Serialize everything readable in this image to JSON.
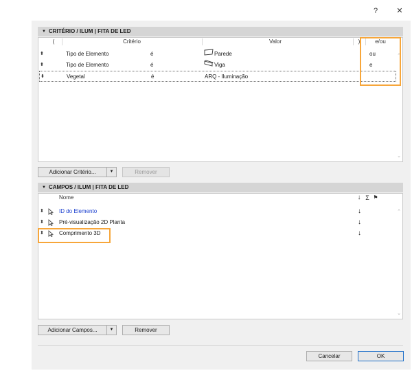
{
  "window": {
    "help": "?",
    "close": "✕"
  },
  "criteria": {
    "title": "CRITÉRIO / ILUM | FITA DE LED",
    "columns": {
      "open_paren": "(",
      "criterio": "Critério",
      "valor": "Valor",
      "close_paren": ")",
      "eou": "e/ou"
    },
    "rows": [
      {
        "criterio": "Tipo de Elemento",
        "op": "é",
        "icon": "wall-icon",
        "valor": "Parede",
        "eou": "ou"
      },
      {
        "criterio": "Tipo de Elemento",
        "op": "é",
        "icon": "beam-icon",
        "valor": "Viga",
        "eou": "e"
      },
      {
        "criterio": "Vegetal",
        "op": "é",
        "icon": "",
        "valor": "ARQ - Iluminação",
        "eou": ""
      }
    ],
    "add_button": "Adicionar Critério...",
    "remove_button": "Remover"
  },
  "fields": {
    "title": "CAMPOS / ILUM | FITA DE LED",
    "columns": {
      "nome": "Nome",
      "sort": "↓",
      "sum": "Σ",
      "flag": "⚑"
    },
    "rows": [
      {
        "nome": "ID do Elemento",
        "sort": "↓",
        "highlight": true
      },
      {
        "nome": "Pré-visualização 2D Planta",
        "sort": "↓",
        "highlight": false
      },
      {
        "nome": "Comprimento 3D",
        "sort": "↓",
        "highlight": false
      }
    ],
    "add_button": "Adicionar Campos...",
    "remove_button": "Remover"
  },
  "footer": {
    "cancel": "Cancelar",
    "ok": "OK"
  },
  "colors": {
    "accent_blue": "#1a3fcf",
    "highlight_orange": "#f7a63a",
    "header_gray": "#d5d5d5"
  }
}
